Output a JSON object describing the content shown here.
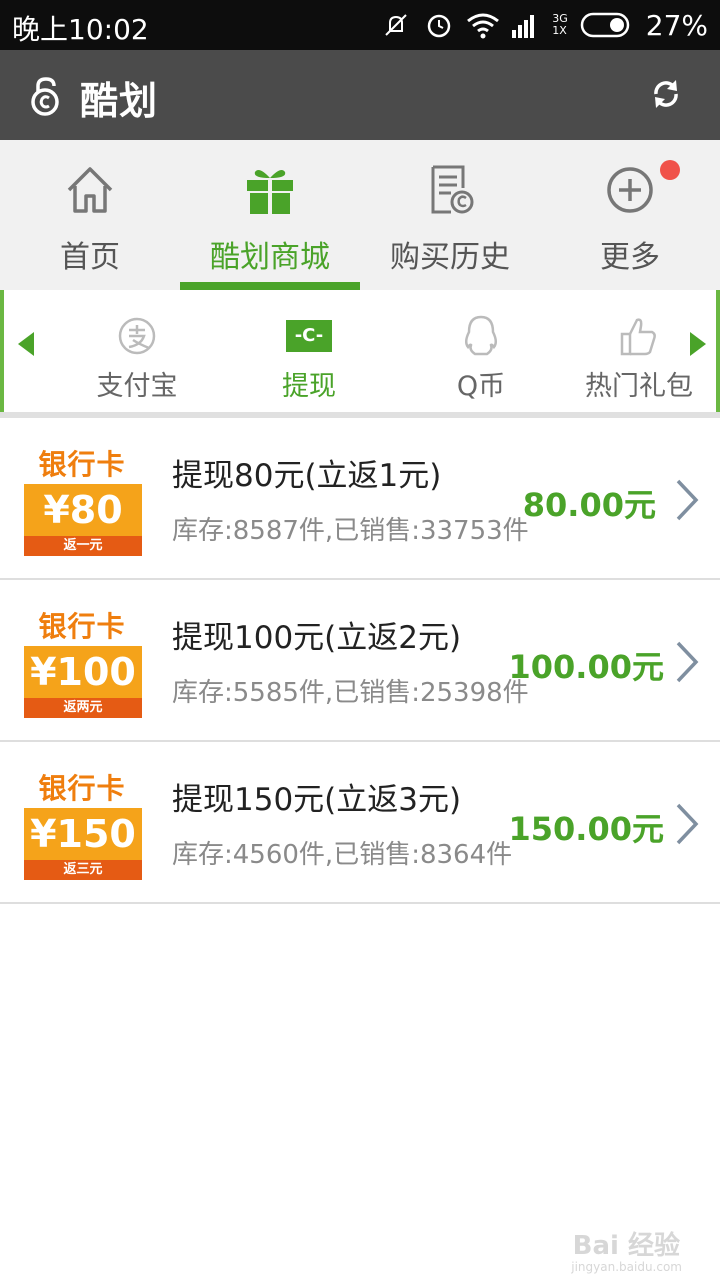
{
  "status_bar": {
    "time": "晚上10:02",
    "network": "3G",
    "network_sub": "1X",
    "battery": "27%",
    "icons": [
      "mute-icon",
      "alarm-icon",
      "wifi-icon",
      "signal-icon",
      "battery-icon"
    ]
  },
  "app_bar": {
    "title": "酷划",
    "logo_icon": "lock-logo-icon",
    "refresh_icon": "refresh-icon"
  },
  "main_nav": {
    "active_index": 1,
    "accent": "#4aa329",
    "tabs": [
      {
        "label": "首页",
        "icon": "home-icon"
      },
      {
        "label": "酷划商城",
        "icon": "gift-icon"
      },
      {
        "label": "购买历史",
        "icon": "receipt-icon"
      },
      {
        "label": "更多",
        "icon": "plus-circle-icon",
        "badge": true
      }
    ]
  },
  "sub_nav": {
    "active_index": 1,
    "items": [
      {
        "label": "支付宝",
        "icon": "alipay-icon"
      },
      {
        "label": "提现",
        "icon": "cash-icon",
        "icon_text": "-C-"
      },
      {
        "label": "Q币",
        "icon": "qq-icon"
      },
      {
        "label": "热门礼包",
        "icon": "thumbs-up-icon"
      }
    ]
  },
  "products": [
    {
      "card_head": "银行卡",
      "card_value": "¥80",
      "card_note": "返一元",
      "title": "提现80元(立返1元)",
      "stock": "库存:8587件,已销售:33753件",
      "price": "80.00元"
    },
    {
      "card_head": "银行卡",
      "card_value": "¥100",
      "card_note": "返两元",
      "title": "提现100元(立返2元)",
      "stock": "库存:5585件,已销售:25398件",
      "price": "100.00元"
    },
    {
      "card_head": "银行卡",
      "card_value": "¥150",
      "card_note": "返三元",
      "title": "提现150元(立返3元)",
      "stock": "库存:4560件,已销售:8364件",
      "price": "150.00元"
    }
  ],
  "watermark": {
    "text": "Bai 经验",
    "url": "jingyan.baidu.com"
  }
}
